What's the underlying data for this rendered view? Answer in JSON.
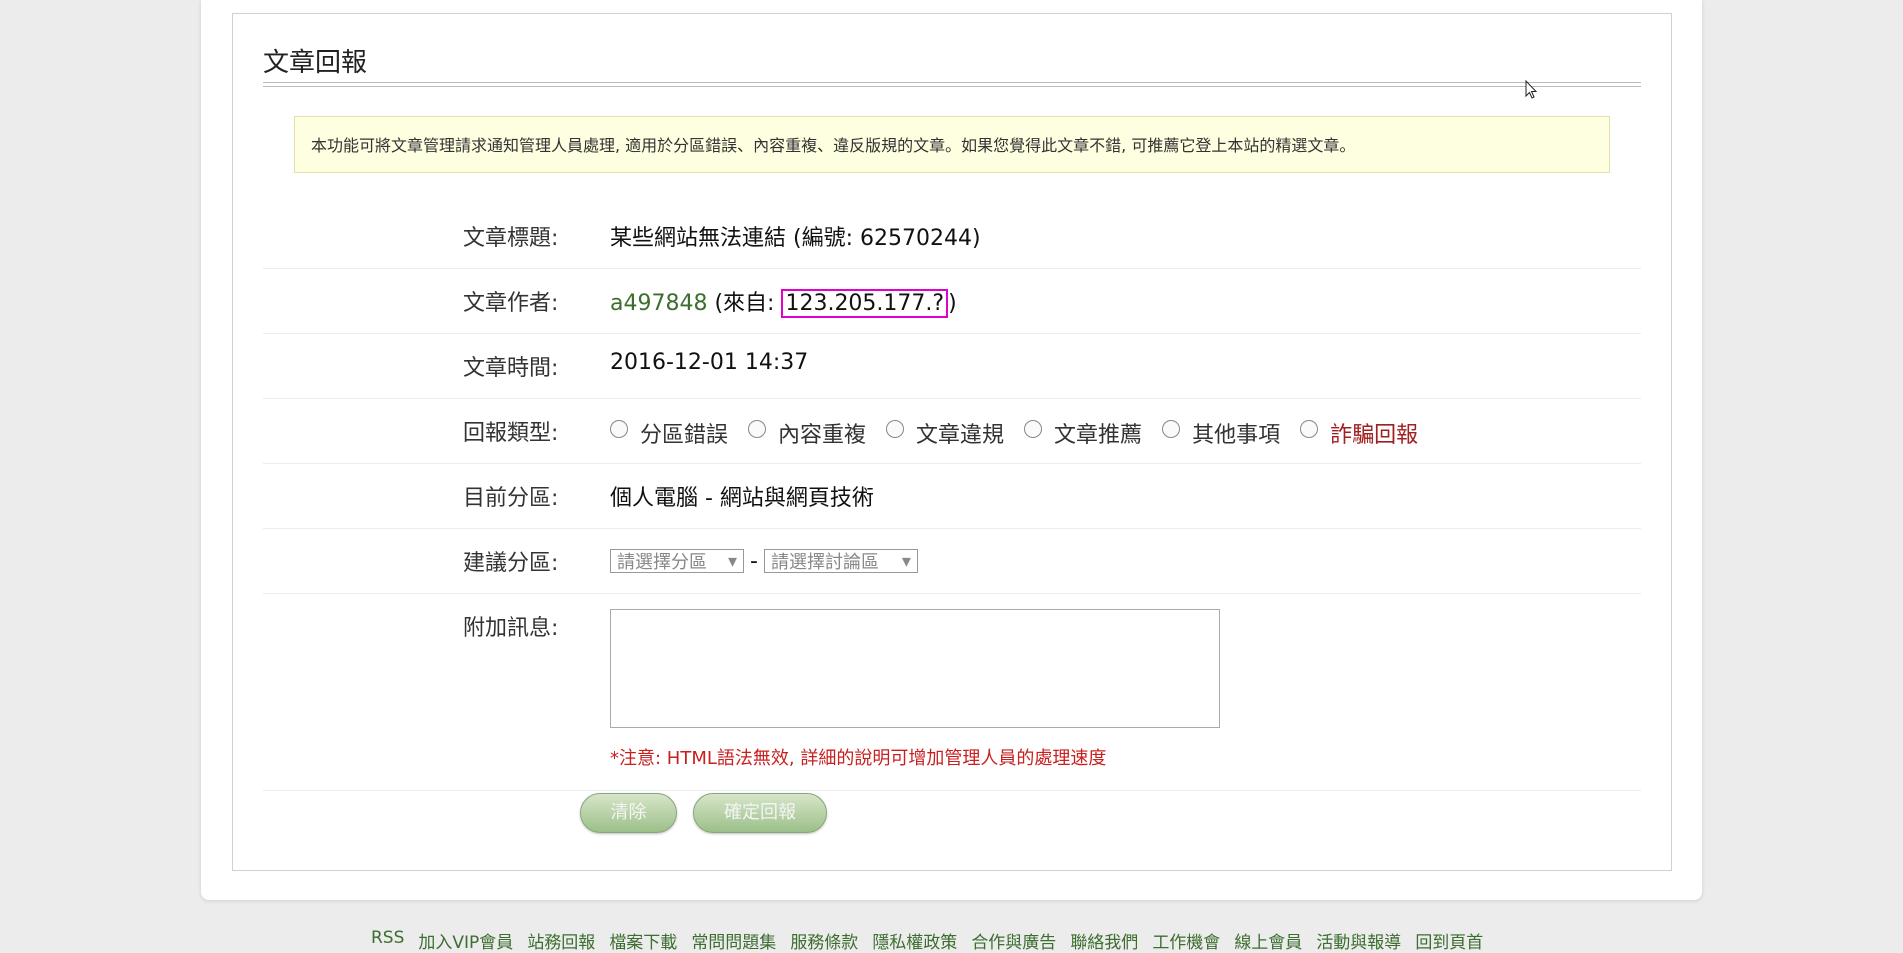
{
  "panel": {
    "title": "文章回報",
    "notice": "本功能可將文章管理請求通知管理人員處理, 適用於分區錯誤、內容重複、違反版規的文章。如果您覺得此文章不錯, 可推薦它登上本站的精選文章。"
  },
  "fields": {
    "title_label": "文章標題:",
    "title_value": "某些網站無法連結 (編號: 62570244)",
    "author_label": "文章作者:",
    "author_name": "a497848",
    "author_from_prefix": " (來自: ",
    "author_ip": "123.205.177.?",
    "author_from_suffix": ")",
    "time_label": "文章時間:",
    "time_value": "2016-12-01 14:37",
    "type_label": "回報類型:",
    "types": [
      "分區錯誤",
      "內容重複",
      "文章違規",
      "文章推薦",
      "其他事項",
      "詐騙回報"
    ],
    "current_label": "目前分區:",
    "current_value": "個人電腦 - 網站與網頁技術",
    "suggest_label": "建議分區:",
    "suggest_select1": "請選擇分區",
    "suggest_sep": "-",
    "suggest_select2": "請選擇討論區",
    "extra_label": "附加訊息:",
    "note": "*注意: HTML語法無效, 詳細的說明可增加管理人員的處理速度"
  },
  "buttons": {
    "clear": "清除",
    "submit": "確定回報"
  },
  "footer": {
    "links": [
      "RSS",
      "加入VIP會員",
      "站務回報",
      "檔案下載",
      "常問問題集",
      "服務條款",
      "隱私權政策",
      "合作與廣告",
      "聯絡我們",
      "工作機會",
      "線上會員",
      "活動與報導",
      "回到頁首"
    ]
  },
  "colors": {
    "link": "#3c6e2f",
    "warning": "#c82020",
    "highlight_box": "#e000d0",
    "button": "#9cc08a"
  }
}
